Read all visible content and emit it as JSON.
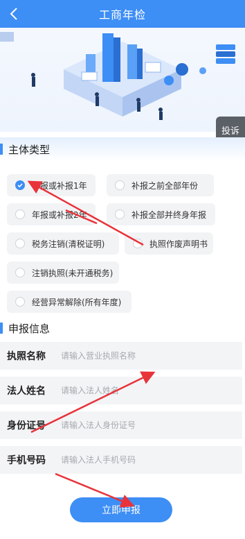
{
  "nav": {
    "title": "工商年检",
    "back_icon": "chevron-left-icon"
  },
  "complain_button": "投诉",
  "section_type": {
    "title": "主体类型"
  },
  "options": [
    {
      "label": "年报或补报1年",
      "checked": true
    },
    {
      "label": "补报之前全部年份",
      "checked": false
    },
    {
      "label": "年报或补报2年",
      "checked": false
    },
    {
      "label": "补报全部并终身年报",
      "checked": false
    },
    {
      "label": "税务注销(清税证明)",
      "checked": false
    },
    {
      "label": "执照作废声明书",
      "checked": false
    },
    {
      "label": "注销执照(未开通税务)",
      "checked": false
    },
    {
      "label": "经营异常解除(所有年度)",
      "checked": false
    }
  ],
  "section_info": {
    "title": "申报信息"
  },
  "fields": [
    {
      "label": "执照名称",
      "placeholder": "请输入营业执照名称"
    },
    {
      "label": "法人姓名",
      "placeholder": "请输入法人姓名"
    },
    {
      "label": "身份证号",
      "placeholder": "请输入法人身份证号"
    },
    {
      "label": "手机号码",
      "placeholder": "请输入法人手机号码"
    }
  ],
  "submit_label": "立即申报",
  "colors": {
    "primary": "#3d8ef5",
    "annotation": "#e8333a"
  }
}
